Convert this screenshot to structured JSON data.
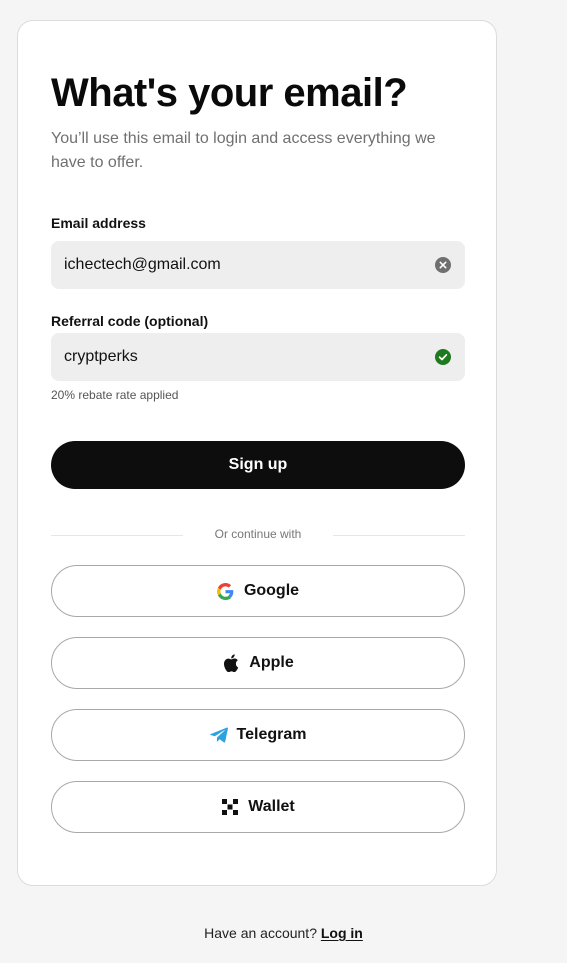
{
  "header": {
    "title": "What's your email?",
    "subtitle": "You’ll use this email to login and access everything we have to offer."
  },
  "email": {
    "label": "Email address",
    "value": "ichectech@gmail.com",
    "end_icon": "clear-icon"
  },
  "referral": {
    "label": "Referral code (optional)",
    "value": "cryptperks",
    "end_icon": "check-circle-icon",
    "hint": "20% rebate rate applied"
  },
  "signup": {
    "label": "Sign up"
  },
  "divider": {
    "text": "Or continue with"
  },
  "social": {
    "google": {
      "label": "Google",
      "icon": "google-icon"
    },
    "apple": {
      "label": "Apple",
      "icon": "apple-icon"
    },
    "telegram": {
      "label": "Telegram",
      "icon": "telegram-icon"
    },
    "wallet": {
      "label": "Wallet",
      "icon": "wallet-icon"
    }
  },
  "footer": {
    "prompt": "Have an account?",
    "login_label": "Log in"
  },
  "colors": {
    "primary_button": "#0d0d0d",
    "success": "#1f7a1f",
    "telegram": "#2aa3e0",
    "field_bg": "#eeeeee",
    "page_bg": "#f5f5f5"
  }
}
